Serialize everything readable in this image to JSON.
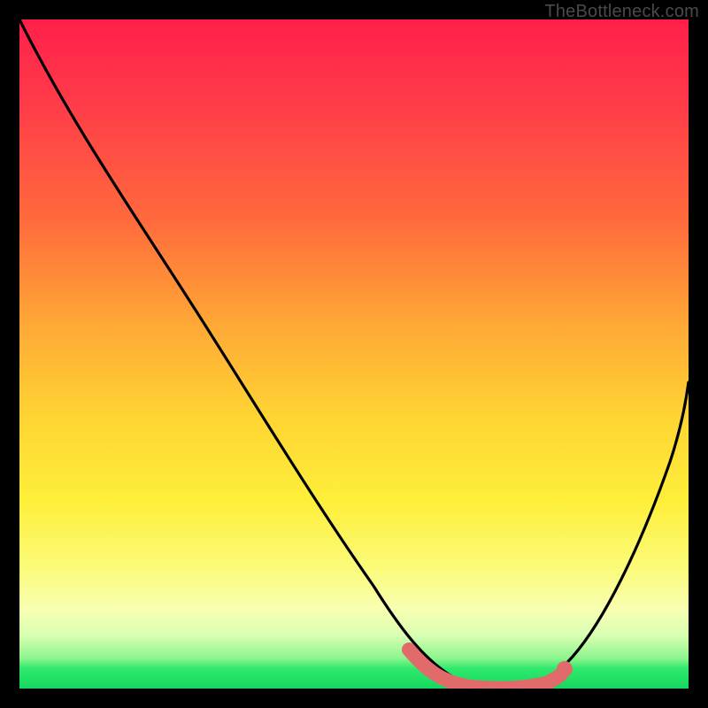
{
  "watermark": "TheBottleneck.com",
  "chart_data": {
    "type": "line",
    "title": "",
    "xlabel": "",
    "ylabel": "",
    "xlim": [
      0,
      100
    ],
    "ylim": [
      0,
      100
    ],
    "series": [
      {
        "name": "bottleneck-curve",
        "x": [
          0,
          10,
          20,
          30,
          40,
          50,
          58,
          63,
          68,
          72,
          76,
          80,
          86,
          92,
          100
        ],
        "values": [
          100,
          86,
          72,
          58,
          44,
          30,
          16,
          6,
          1,
          0,
          0,
          2,
          12,
          26,
          50
        ]
      },
      {
        "name": "highlight-band",
        "x": [
          58,
          63,
          68,
          72,
          76,
          80
        ],
        "values": [
          3,
          1,
          0,
          0,
          0,
          2
        ]
      }
    ],
    "marker": {
      "x": 80,
      "y": 2
    },
    "colors": {
      "curve": "#000000",
      "highlight": "#e16a6a",
      "marker": "#e16a6a"
    }
  }
}
